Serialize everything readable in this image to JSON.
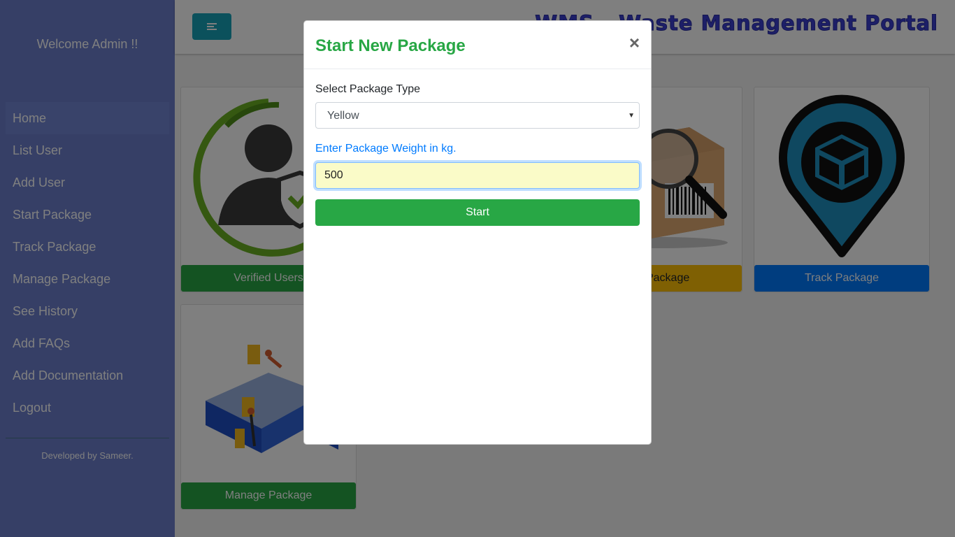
{
  "sidebar": {
    "welcome": "Welcome Admin !!",
    "items": [
      {
        "label": "Home"
      },
      {
        "label": "List User"
      },
      {
        "label": "Add User"
      },
      {
        "label": "Start Package"
      },
      {
        "label": "Track Package"
      },
      {
        "label": "Manage Package"
      },
      {
        "label": "See History"
      },
      {
        "label": "Add FAQs"
      },
      {
        "label": "Add Documentation"
      },
      {
        "label": "Logout"
      }
    ],
    "footer": "Developed by Sameer."
  },
  "header": {
    "title": "WMS - Waste Management Portal"
  },
  "cards": [
    {
      "label": "Verified Users",
      "icon": "verified-user-icon",
      "color": "#28a745"
    },
    {
      "label": "Start Package",
      "icon": "package-search-icon",
      "color": "#ffc107"
    },
    {
      "label": "Track Package",
      "icon": "location-pin-box-icon",
      "color": "#007bff"
    },
    {
      "label": "Manage Package",
      "icon": "warehouse-icon",
      "color": "#28a745"
    }
  ],
  "modal": {
    "title": "Start New Package",
    "close": "×",
    "type_label": "Select Package Type",
    "type_value": "Yellow",
    "weight_label": "Enter Package Weight in kg.",
    "weight_value": "500",
    "submit_label": "Start"
  }
}
